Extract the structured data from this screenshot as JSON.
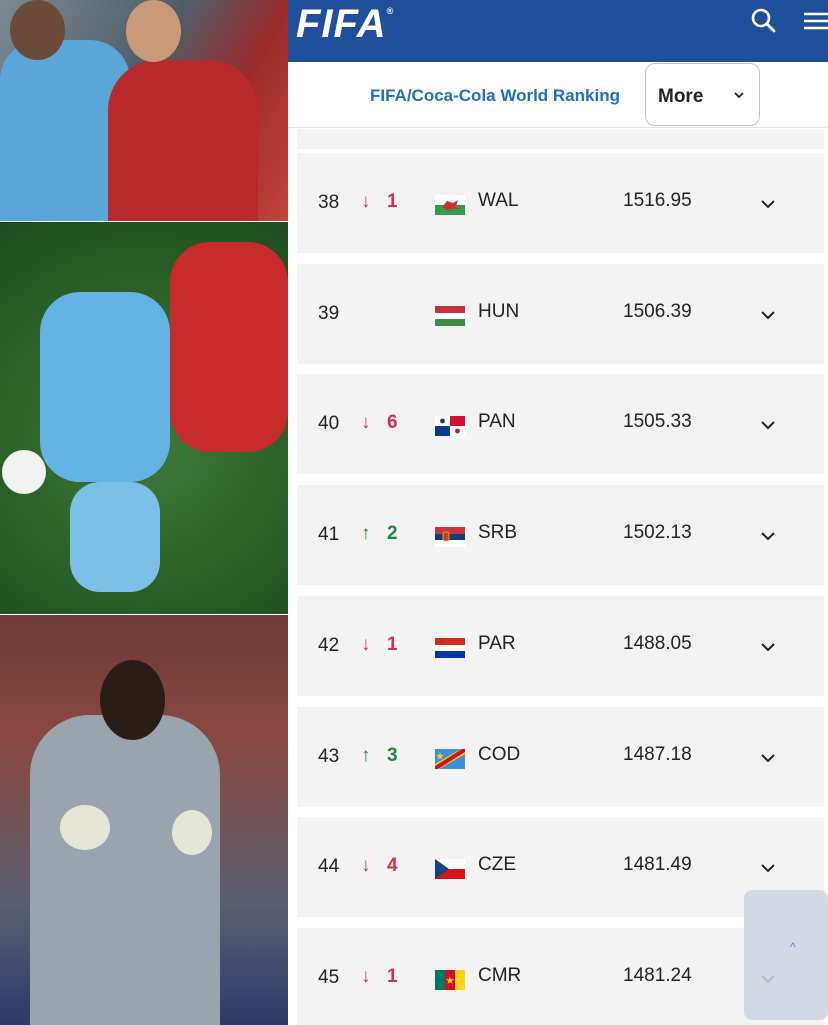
{
  "header": {
    "logo_text": "FIFA",
    "logo_mark": "®",
    "brand_color": "#1f4e9a",
    "icons": [
      "search-icon",
      "hamburger-menu-icon"
    ]
  },
  "subheader": {
    "title": "FIFA/Coca-Cola World Ranking",
    "more_label": "More"
  },
  "colors": {
    "down": "#d8304a",
    "up": "#1d8a3a",
    "row_bg": "#f3f3f4",
    "link": "#1f6fc0"
  },
  "rankings": [
    {
      "rank": "38",
      "direction": "down",
      "change": "1",
      "flag": "wales",
      "team": "WAL",
      "points": "1516.95"
    },
    {
      "rank": "39",
      "direction": "none",
      "change": "",
      "flag": "hungary",
      "team": "HUN",
      "points": "1506.39"
    },
    {
      "rank": "40",
      "direction": "down",
      "change": "6",
      "flag": "panama",
      "team": "PAN",
      "points": "1505.33"
    },
    {
      "rank": "41",
      "direction": "up",
      "change": "2",
      "flag": "serbia",
      "team": "SRB",
      "points": "1502.13"
    },
    {
      "rank": "42",
      "direction": "down",
      "change": "1",
      "flag": "paraguay",
      "team": "PAR",
      "points": "1488.05"
    },
    {
      "rank": "43",
      "direction": "up",
      "change": "3",
      "flag": "dr-congo",
      "team": "COD",
      "points": "1487.18"
    },
    {
      "rank": "44",
      "direction": "down",
      "change": "4",
      "flag": "czechia",
      "team": "CZE",
      "points": "1481.49"
    },
    {
      "rank": "45",
      "direction": "down",
      "change": "1",
      "flag": "cameroon",
      "team": "CMR",
      "points": "1481.24"
    }
  ],
  "arrows": {
    "down": "↓",
    "up": "↑"
  },
  "scroll_top": {
    "icon": "chevron-up-icon",
    "glyph": "^"
  }
}
